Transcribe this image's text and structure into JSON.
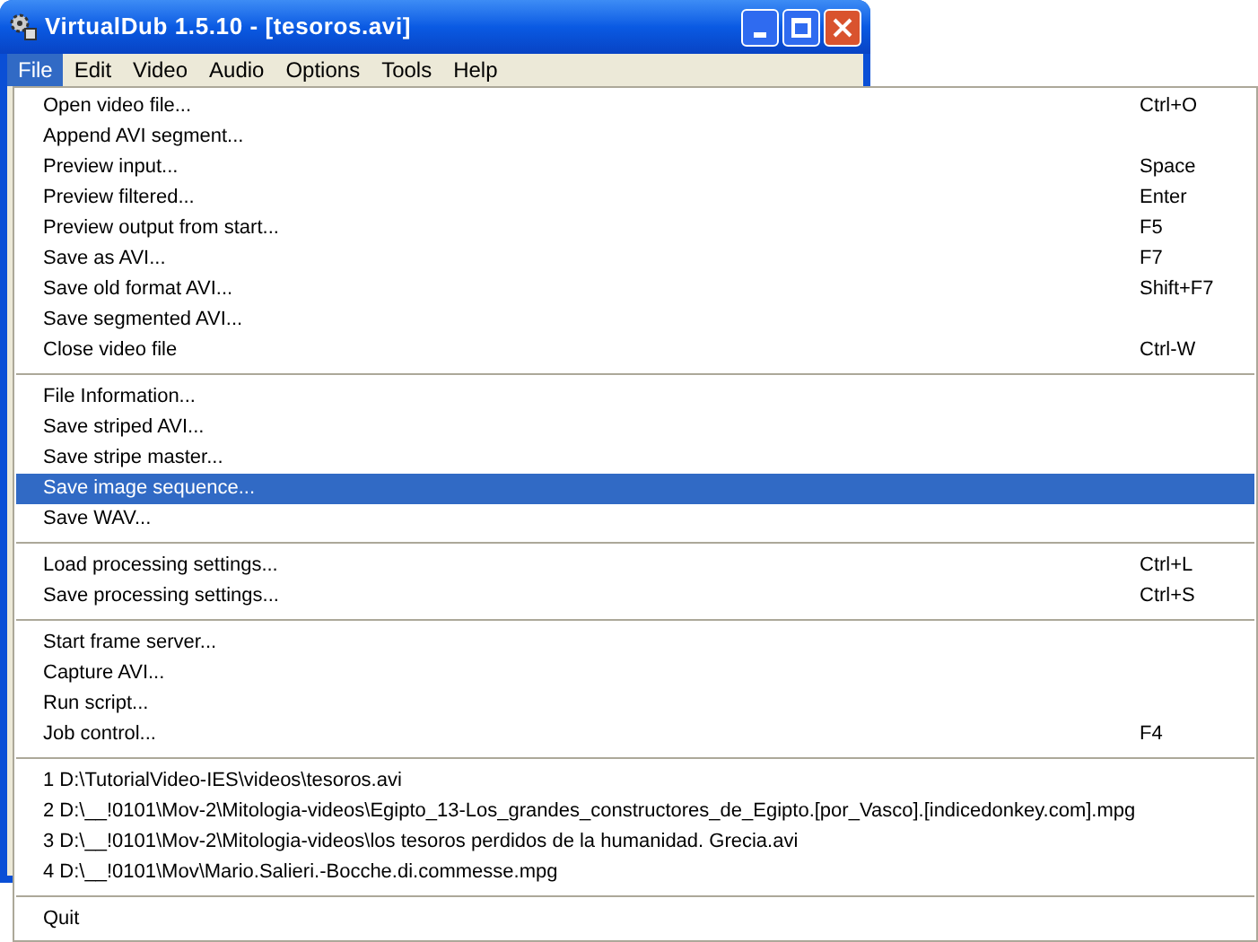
{
  "window": {
    "title": "VirtualDub 1.5.10 - [tesoros.avi]"
  },
  "menubar": [
    {
      "label": "File",
      "selected": true
    },
    {
      "label": "Edit",
      "selected": false
    },
    {
      "label": "Video",
      "selected": false
    },
    {
      "label": "Audio",
      "selected": false
    },
    {
      "label": "Options",
      "selected": false
    },
    {
      "label": "Tools",
      "selected": false
    },
    {
      "label": "Help",
      "selected": false
    }
  ],
  "menu": {
    "sections": [
      {
        "items": [
          {
            "label": "Open video file...",
            "shortcut": "Ctrl+O",
            "selected": false
          },
          {
            "label": "Append AVI segment...",
            "selected": false
          },
          {
            "label": "Preview input...",
            "shortcut": "Space",
            "selected": false
          },
          {
            "label": "Preview filtered...",
            "shortcut": "Enter",
            "selected": false
          },
          {
            "label": "Preview output from start...",
            "shortcut": "F5",
            "selected": false
          },
          {
            "label": "Save as AVI...",
            "shortcut": "F7",
            "selected": false
          },
          {
            "label": "Save old format AVI...",
            "shortcut": "Shift+F7",
            "selected": false
          },
          {
            "label": "Save segmented AVI...",
            "selected": false
          },
          {
            "label": "Close video file",
            "shortcut": "Ctrl-W",
            "selected": false
          }
        ]
      },
      {
        "items": [
          {
            "label": "File Information...",
            "selected": false
          },
          {
            "label": "Save striped AVI...",
            "selected": false
          },
          {
            "label": "Save stripe master...",
            "selected": false
          },
          {
            "label": "Save image sequence...",
            "selected": true
          },
          {
            "label": "Save WAV...",
            "selected": false
          }
        ]
      },
      {
        "items": [
          {
            "label": "Load processing settings...",
            "shortcut": "Ctrl+L",
            "selected": false
          },
          {
            "label": "Save processing settings...",
            "shortcut": "Ctrl+S",
            "selected": false
          }
        ]
      },
      {
        "items": [
          {
            "label": "Start frame server...",
            "selected": false
          },
          {
            "label": "Capture AVI...",
            "selected": false
          },
          {
            "label": "Run script...",
            "selected": false
          },
          {
            "label": "Job control...",
            "shortcut": "F4",
            "selected": false
          }
        ]
      },
      {
        "items": [
          {
            "label": "1 D:\\TutorialVideo-IES\\videos\\tesoros.avi",
            "selected": false
          },
          {
            "label": "2 D:\\__!0101\\Mov-2\\Mitologia-videos\\Egipto_13-Los_grandes_constructores_de_Egipto.[por_Vasco].[indicedonkey.com].mpg",
            "selected": false
          },
          {
            "label": "3 D:\\__!0101\\Mov-2\\Mitologia-videos\\los tesoros perdidos de la humanidad. Grecia.avi",
            "selected": false
          },
          {
            "label": "4 D:\\__!0101\\Mov\\Mario.Salieri.-Bocche.di.commesse.mpg",
            "selected": false
          }
        ]
      },
      {
        "items": [
          {
            "label": "Quit",
            "selected": false
          }
        ]
      }
    ]
  }
}
